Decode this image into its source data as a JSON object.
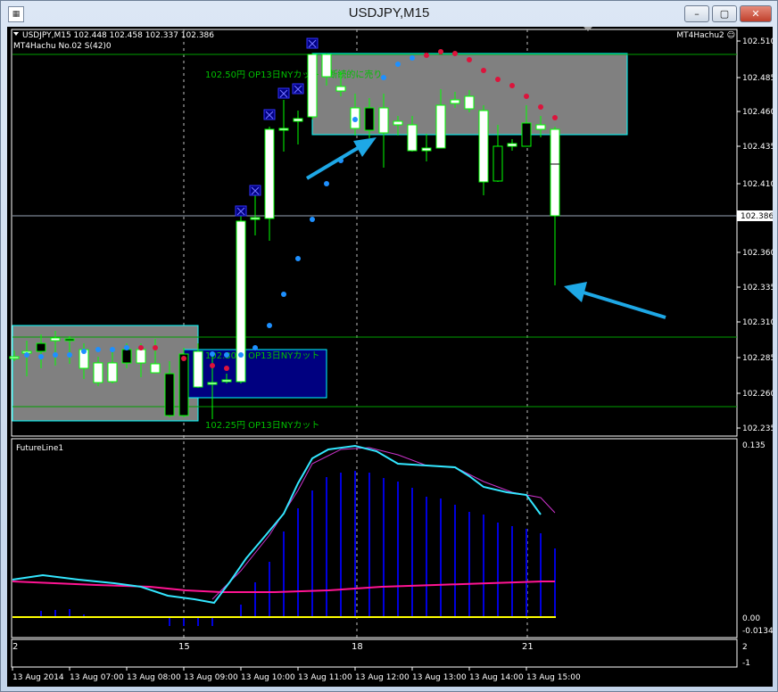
{
  "window": {
    "title": "USDJPY,M15",
    "minimize_label": "–",
    "maximize_label": "▢",
    "close_label": "✕"
  },
  "header": {
    "symbol_line": "USDJPY,M15  102.448 102.458 102.337 102.386",
    "indicator_label": "MT4Hachu  No.02  S(42)0",
    "ea_label": "MT4Hachu2 ☺"
  },
  "price_axis": {
    "ticks": [
      "102.510",
      "102.485",
      "102.460",
      "102.435",
      "102.410",
      "102.386",
      "102.360",
      "102.335",
      "102.310",
      "102.285",
      "102.260",
      "102.235"
    ],
    "current_price": "102.386"
  },
  "annotations": {
    "upper": "102.50円  OP13日NYカット・断続的に売り",
    "mid": "102.30円  OP13日NYカット",
    "lower": "102.25円  OP13日NYカット"
  },
  "subwindow": {
    "title": "FutureLine1",
    "ticks": [
      "0.135",
      "0.00",
      "-0.0134"
    ]
  },
  "hour_axis": {
    "labels": [
      "2",
      "15",
      "18",
      "21"
    ],
    "right_ticks": [
      "2",
      "-1"
    ]
  },
  "time_axis": {
    "labels": [
      "13 Aug 2014",
      "13 Aug 07:00",
      "13 Aug 08:00",
      "13 Aug 09:00",
      "13 Aug 10:00",
      "13 Aug 11:00",
      "13 Aug 12:00",
      "13 Aug 13:00",
      "13 Aug 14:00",
      "13 Aug 15:00"
    ]
  },
  "colors": {
    "background": "#000000",
    "bull_candle": "#ffffff",
    "candle_outline": "#00ff00",
    "level_line": "#008000",
    "zone_gray": "#808080",
    "zone_blue": "#000080",
    "zone_border": "#00ffff",
    "arrow": "#1ea8e6",
    "dot_blue": "#1e90ff",
    "dot_red": "#dc143c",
    "marker": "#3333ff",
    "histogram": "#0000cc",
    "signal_cyan": "#33e6ff",
    "signal_pink": "#ff1493",
    "zero_line": "#ffff00"
  }
}
